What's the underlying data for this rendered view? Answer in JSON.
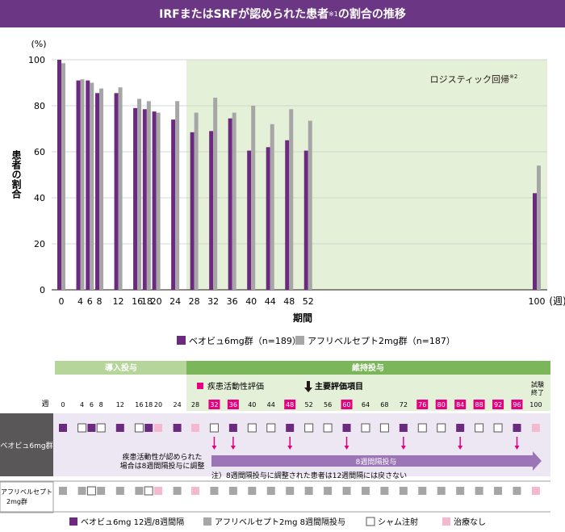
{
  "title": {
    "main": "IRFまたはSRFが認められた患者",
    "sup": "※1",
    "suffix": "の割合の推移"
  },
  "chart_data": {
    "type": "bar",
    "ylabel": "患者の割合",
    "yunit": "(%)",
    "xlabel": "期間",
    "ylim": [
      0,
      100
    ],
    "yticks": [
      0,
      20,
      40,
      60,
      80,
      100
    ],
    "grid": true,
    "xtick_labels": [
      "0",
      "4",
      "6",
      "8",
      "12",
      "16",
      "18",
      "20",
      "24",
      "28",
      "32",
      "36",
      "40",
      "44",
      "48",
      "52",
      "100"
    ],
    "x_unit_label": "(週)",
    "shaded_region": {
      "from_week": 26,
      "to_week": 100,
      "label": "ロジスティック回帰",
      "label_sup": "※2"
    },
    "series": [
      {
        "name": "ベオビュ6mg群(n=189)",
        "color": "#6b2a80",
        "x": [
          0,
          4,
          6,
          8,
          12,
          16,
          18,
          20,
          24,
          28,
          32,
          36,
          40,
          44,
          48,
          52,
          100
        ],
        "values": [
          100,
          91,
          91,
          85.5,
          85.5,
          79,
          78.5,
          77.5,
          74,
          68.5,
          69,
          74.5,
          60.5,
          62,
          65,
          60.5,
          42
        ]
      },
      {
        "name": "アフリベルセプト2mg群(n=187)",
        "color": "#a6a6a6",
        "x": [
          0,
          4,
          6,
          8,
          12,
          16,
          18,
          20,
          24,
          28,
          32,
          36,
          40,
          44,
          48,
          52,
          100
        ],
        "values": [
          98.5,
          91.5,
          90,
          87.5,
          88,
          83,
          82,
          77,
          82,
          77,
          83.5,
          77,
          80,
          72,
          78.5,
          73.5,
          54
        ]
      }
    ]
  },
  "legend": {
    "a": "ベオビュ6mg群（n=189）",
    "b": "アフリベルセプト2mg群（n=187）"
  },
  "schedule": {
    "phase_load": "導入投与",
    "phase_maint": "維持投与",
    "assess_label": "疾患活動性評価",
    "primary_label": "主要評価項目",
    "week_label": "週",
    "weeks": [
      "0",
      "4",
      "6",
      "8",
      "12",
      "16",
      "18",
      "20",
      "24",
      "28",
      "32",
      "36",
      "40",
      "44",
      "48",
      "52",
      "56",
      "60",
      "64",
      "68",
      "72",
      "76",
      "80",
      "84",
      "88",
      "92",
      "96",
      "100"
    ],
    "highlight_weeks": [
      "32",
      "36",
      "48",
      "60",
      "76",
      "80",
      "84",
      "88",
      "92",
      "96"
    ],
    "end_label_1": "試験",
    "end_label_2": "終了",
    "row_a_label": "ベオビュ6mg群",
    "row_b_label_1": "アフリベルセプト",
    "row_b_label_2": "2mg群",
    "row_a": [
      "p",
      "s",
      "p",
      "s",
      "p",
      "s",
      "p",
      "n",
      "p",
      "n",
      "s",
      "p",
      "s",
      "s",
      "p",
      "s",
      "s",
      "p",
      "s",
      "s",
      "p",
      "s",
      "s",
      "p",
      "s",
      "s",
      "p",
      "n"
    ],
    "row_b": [
      "g",
      "g",
      "s",
      "g",
      "g",
      "g",
      "s",
      "n",
      "g",
      "n",
      "g",
      "g",
      "g",
      "g",
      "g",
      "g",
      "g",
      "g",
      "g",
      "g",
      "g",
      "g",
      "g",
      "g",
      "g",
      "g",
      "g",
      "n"
    ],
    "note_adjust_1": "疾患活動性が認められた",
    "note_adjust_2": "場合は8週間隔投与に調整",
    "arrow_8week": "8週間隔投与",
    "note_fixed": "注）8週間隔投与に調整された患者は12週間隔には戻さない",
    "legend_p": "ベオビュ6mg 12週/8週間隔",
    "legend_g": "アフリベルセプト2mg 8週間隔投与",
    "legend_s": "シャム注射",
    "legend_n": "治療なし",
    "colors": {
      "purple": "#6b2a80",
      "gray": "#a6a6a6",
      "pink": "#f4b8cf",
      "magenta": "#e4007f",
      "green": "#7cb65b",
      "lightgreen": "#e5f0d8",
      "lavender": "#ede7f3"
    }
  }
}
